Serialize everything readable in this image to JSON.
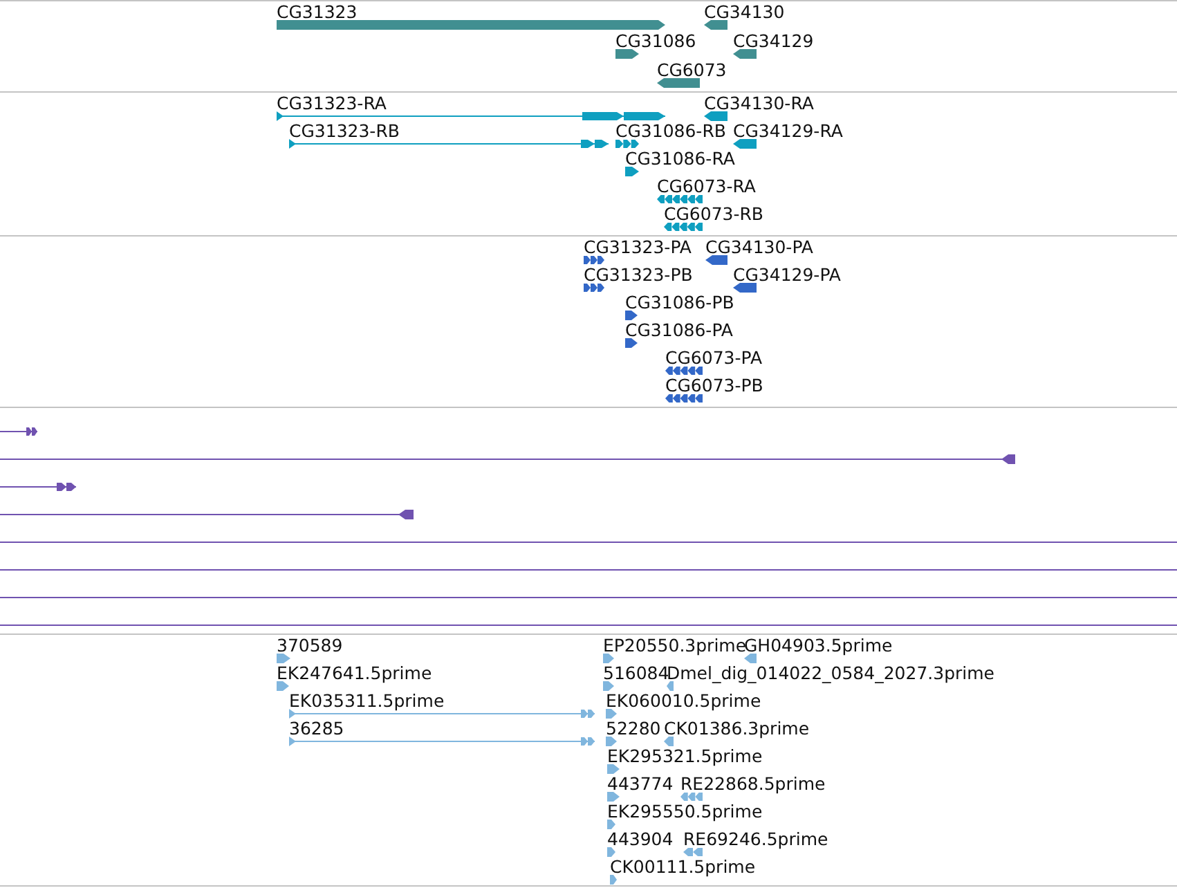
{
  "tracks": [
    {
      "kind": "gene",
      "color": "#418f91",
      "features": [
        {
          "label": "CG31323",
          "reverse": false
        },
        {
          "label": "CG34130",
          "reverse": true
        },
        {
          "label": "CG31086",
          "reverse": false
        },
        {
          "label": "CG34129",
          "reverse": true
        },
        {
          "label": "CG6073",
          "reverse": true
        }
      ]
    },
    {
      "kind": "transcript",
      "color": "#0f9fc0",
      "features": [
        {
          "label": "CG31323-RA",
          "reverse": false
        },
        {
          "label": "CG34130-RA",
          "reverse": true
        },
        {
          "label": "CG31323-RB",
          "reverse": false
        },
        {
          "label": "CG31086-RB",
          "reverse": false
        },
        {
          "label": "CG34129-RA",
          "reverse": true
        },
        {
          "label": "CG31086-RA",
          "reverse": false
        },
        {
          "label": "CG6073-RA",
          "reverse": true
        },
        {
          "label": "CG6073-RB",
          "reverse": true
        }
      ]
    },
    {
      "kind": "protein",
      "color": "#3368c8",
      "features": [
        {
          "label": "CG31323-PA",
          "reverse": false
        },
        {
          "label": "CG34130-PA",
          "reverse": true
        },
        {
          "label": "CG31323-PB",
          "reverse": false
        },
        {
          "label": "CG34129-PA",
          "reverse": true
        },
        {
          "label": "CG31086-PB",
          "reverse": false
        },
        {
          "label": "CG31086-PA",
          "reverse": false
        },
        {
          "label": "CG6073-PA",
          "reverse": true
        },
        {
          "label": "CG6073-PB",
          "reverse": true
        }
      ]
    },
    {
      "kind": "alignment",
      "color": "#7052b0",
      "features": [
        {
          "kind": "arrow",
          "reverse": false
        },
        {
          "kind": "arrow",
          "reverse": true
        },
        {
          "kind": "arrow",
          "reverse": false
        },
        {
          "kind": "arrow",
          "reverse": true
        },
        {
          "kind": "plain"
        },
        {
          "kind": "plain"
        },
        {
          "kind": "plain"
        },
        {
          "kind": "plain"
        }
      ]
    },
    {
      "kind": "est",
      "color": "#80b6de",
      "features": [
        {
          "label": "370589",
          "reverse": false
        },
        {
          "label": "EP20550.3prime",
          "reverse": false
        },
        {
          "label": "GH04903.5prime",
          "reverse": true
        },
        {
          "label": "EK247641.5prime",
          "reverse": false
        },
        {
          "label": "516084",
          "reverse": false
        },
        {
          "label": "Dmel_dig_014022_0584_2027.3prime",
          "reverse": true
        },
        {
          "label": "EK035311.5prime",
          "reverse": false
        },
        {
          "label": "EK060010.5prime",
          "reverse": false
        },
        {
          "label": "36285",
          "reverse": false
        },
        {
          "label": "52280",
          "reverse": false
        },
        {
          "label": "CK01386.3prime",
          "reverse": true
        },
        {
          "label": "EK295321.5prime",
          "reverse": false
        },
        {
          "label": "443774",
          "reverse": false
        },
        {
          "label": "RE22868.5prime",
          "reverse": true
        },
        {
          "label": "EK295550.5prime",
          "reverse": false
        },
        {
          "label": "443904",
          "reverse": false
        },
        {
          "label": "RE69246.5prime",
          "reverse": true
        },
        {
          "label": "CK00111.5prime",
          "reverse": false
        }
      ]
    }
  ]
}
